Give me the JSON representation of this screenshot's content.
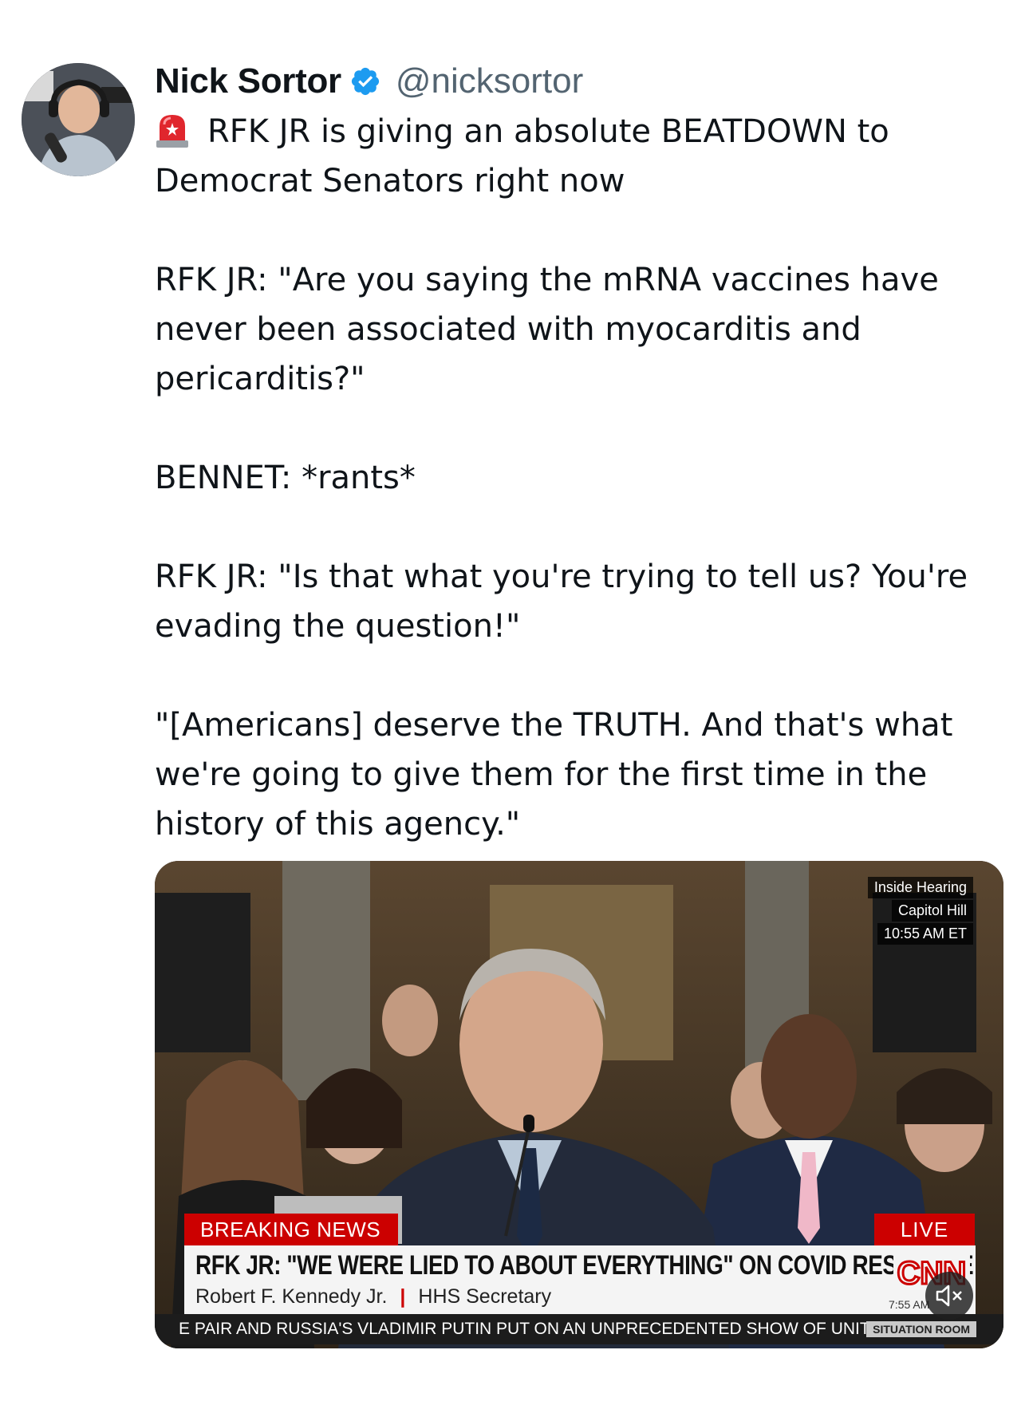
{
  "author": {
    "name": "Nick Sortor",
    "handle": "@nicksortor",
    "verified": true,
    "avatar_icon": "avatar-photo"
  },
  "tweet": {
    "lead_icon": "siren-emoji",
    "line1": "RFK JR is giving an absolute BEATDOWN to Democrat Senators right now",
    "para2": "RFK JR: \"Are you saying the mRNA vaccines have never been associated with myocarditis and pericarditis?\"",
    "para3": "BENNET: *rants*",
    "para4": "RFK JR: \"Is that what you're trying to tell us? You're evading the question!\"",
    "para5": "\"[Americans] deserve the TRUTH. And that's what we're going to give them for the first time in the history of this agency.\""
  },
  "media": {
    "type": "video",
    "info_line1": "Inside Hearing",
    "info_line2": "Capitol Hill",
    "info_line3": "10:55 AM ET",
    "breaking_label": "BREAKING NEWS",
    "live_label": "LIVE",
    "headline": "RFK JR: \"WE WERE LIED TO ABOUT EVERYTHING\" ON COVID RESPONSE",
    "name_label": "Robert F. Kennedy Jr.",
    "title_label": "HHS Secretary",
    "network": "CNN",
    "clock": "7:55 AM",
    "ticker": "E PAIR AND RUSSIA'S VLADIMIR PUTIN PUT ON AN UNPRECEDENTED SHOW OF UNITY /",
    "ticker_brand": "SITUATION ROOM",
    "mute_icon": "speaker-muted-icon"
  },
  "colors": {
    "text": "#0f1419",
    "secondary": "#536471",
    "verified": "#1d9bf0",
    "breaking_red": "#cc0000"
  }
}
